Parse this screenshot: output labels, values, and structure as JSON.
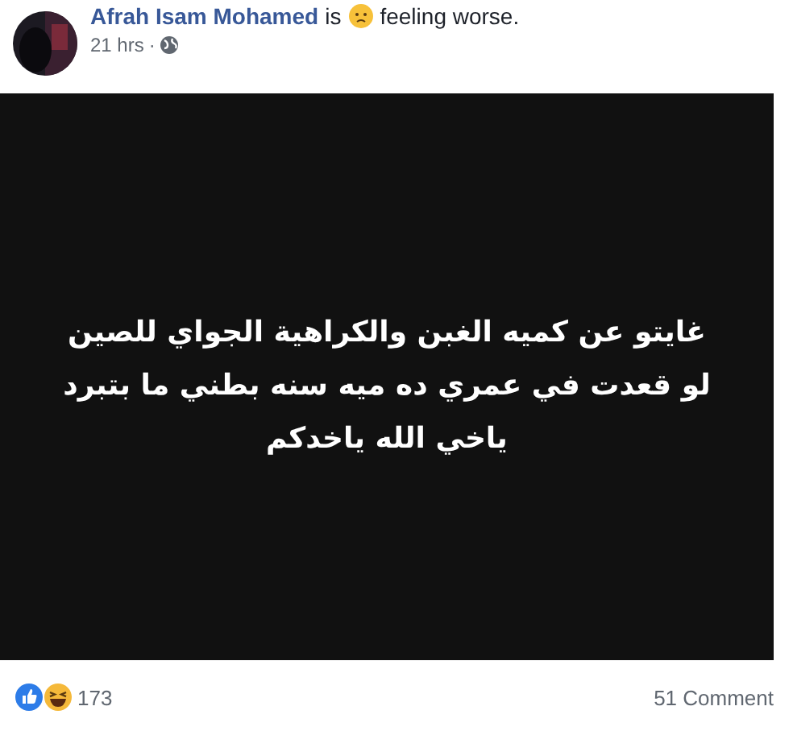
{
  "author": {
    "name": "Afrah Isam Mohamed",
    "verb": "is",
    "feeling": "feeling worse."
  },
  "meta": {
    "time": "21 hrs",
    "separator": "·"
  },
  "post_text": [
    "غايتو عن كميه الغبن والكراهية الجواي للصين",
    "لو قعدت في عمري ده ميه سنه بطني ما بتبرد",
    "ياخي الله ياخدكم"
  ],
  "footer": {
    "reaction_count": "173",
    "comments": "51 Comment"
  }
}
